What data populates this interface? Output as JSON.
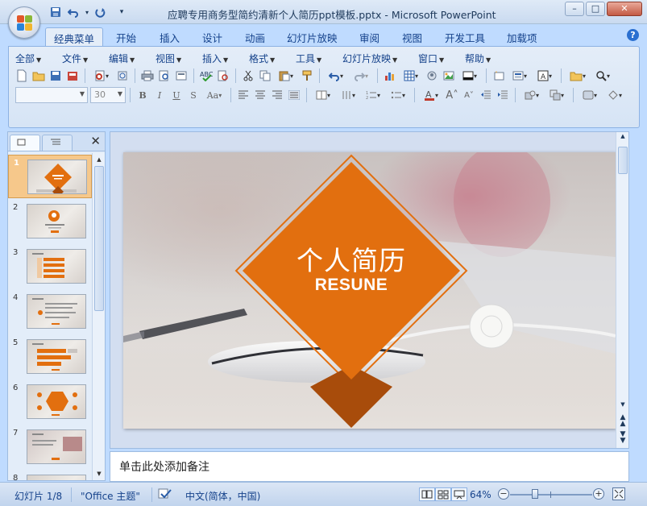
{
  "window": {
    "title": "应聘专用商务型简约清新个人简历ppt模板.pptx - Microsoft PowerPoint",
    "min_label": "–",
    "max_label": "□",
    "close_label": "✕"
  },
  "tabs": [
    "经典菜单",
    "开始",
    "插入",
    "设计",
    "动画",
    "幻灯片放映",
    "审阅",
    "视图",
    "开发工具",
    "加载项"
  ],
  "active_tab": "经典菜单",
  "menus": [
    "全部",
    "文件",
    "编辑",
    "视图",
    "插入",
    "格式",
    "工具",
    "幻灯片放映",
    "窗口",
    "帮助"
  ],
  "format": {
    "font_name": "",
    "font_size": "30"
  },
  "slide_panel": {
    "slides": [
      "1",
      "2",
      "3",
      "4",
      "5",
      "6",
      "7",
      "8"
    ],
    "selected": 1
  },
  "slide": {
    "title": "个人简历",
    "subtitle": "RESUNE",
    "accent": "#e26f0f",
    "dark_accent": "#a84c0b"
  },
  "notes": {
    "placeholder": "单击此处添加备注"
  },
  "status": {
    "slide_info": "幻灯片 1/8",
    "theme": "\"Office 主题\"",
    "language": "中文(简体，中国)",
    "zoom": "64%"
  },
  "colors": {
    "ribbon_bg": "#d6e4f5",
    "orange": "#e26f0f"
  }
}
